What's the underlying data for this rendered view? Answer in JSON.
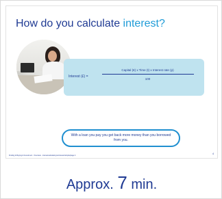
{
  "slide": {
    "title_prefix": "How do you calculate ",
    "title_accent": "interest?",
    "formula": {
      "left": "Interest (£) =",
      "numerator": "Capital (€) x Time (t) x Interest rate (p)",
      "denominator": "100"
    },
    "callout": "With a loan you pay you get back more money than you borrowed from you.",
    "footer": "Finding & Buying & Investment · Overview · interestcalculatoryourinterest/simple/page 4",
    "page_number": "4"
  },
  "duration": {
    "prefix": "Approx.",
    "number": "7",
    "unit": "min."
  },
  "colors": {
    "title": "#1f3a93",
    "accent": "#1e9bd7",
    "formula_bg": "#bfe3ef",
    "callout_border": "#1f8fd0"
  }
}
